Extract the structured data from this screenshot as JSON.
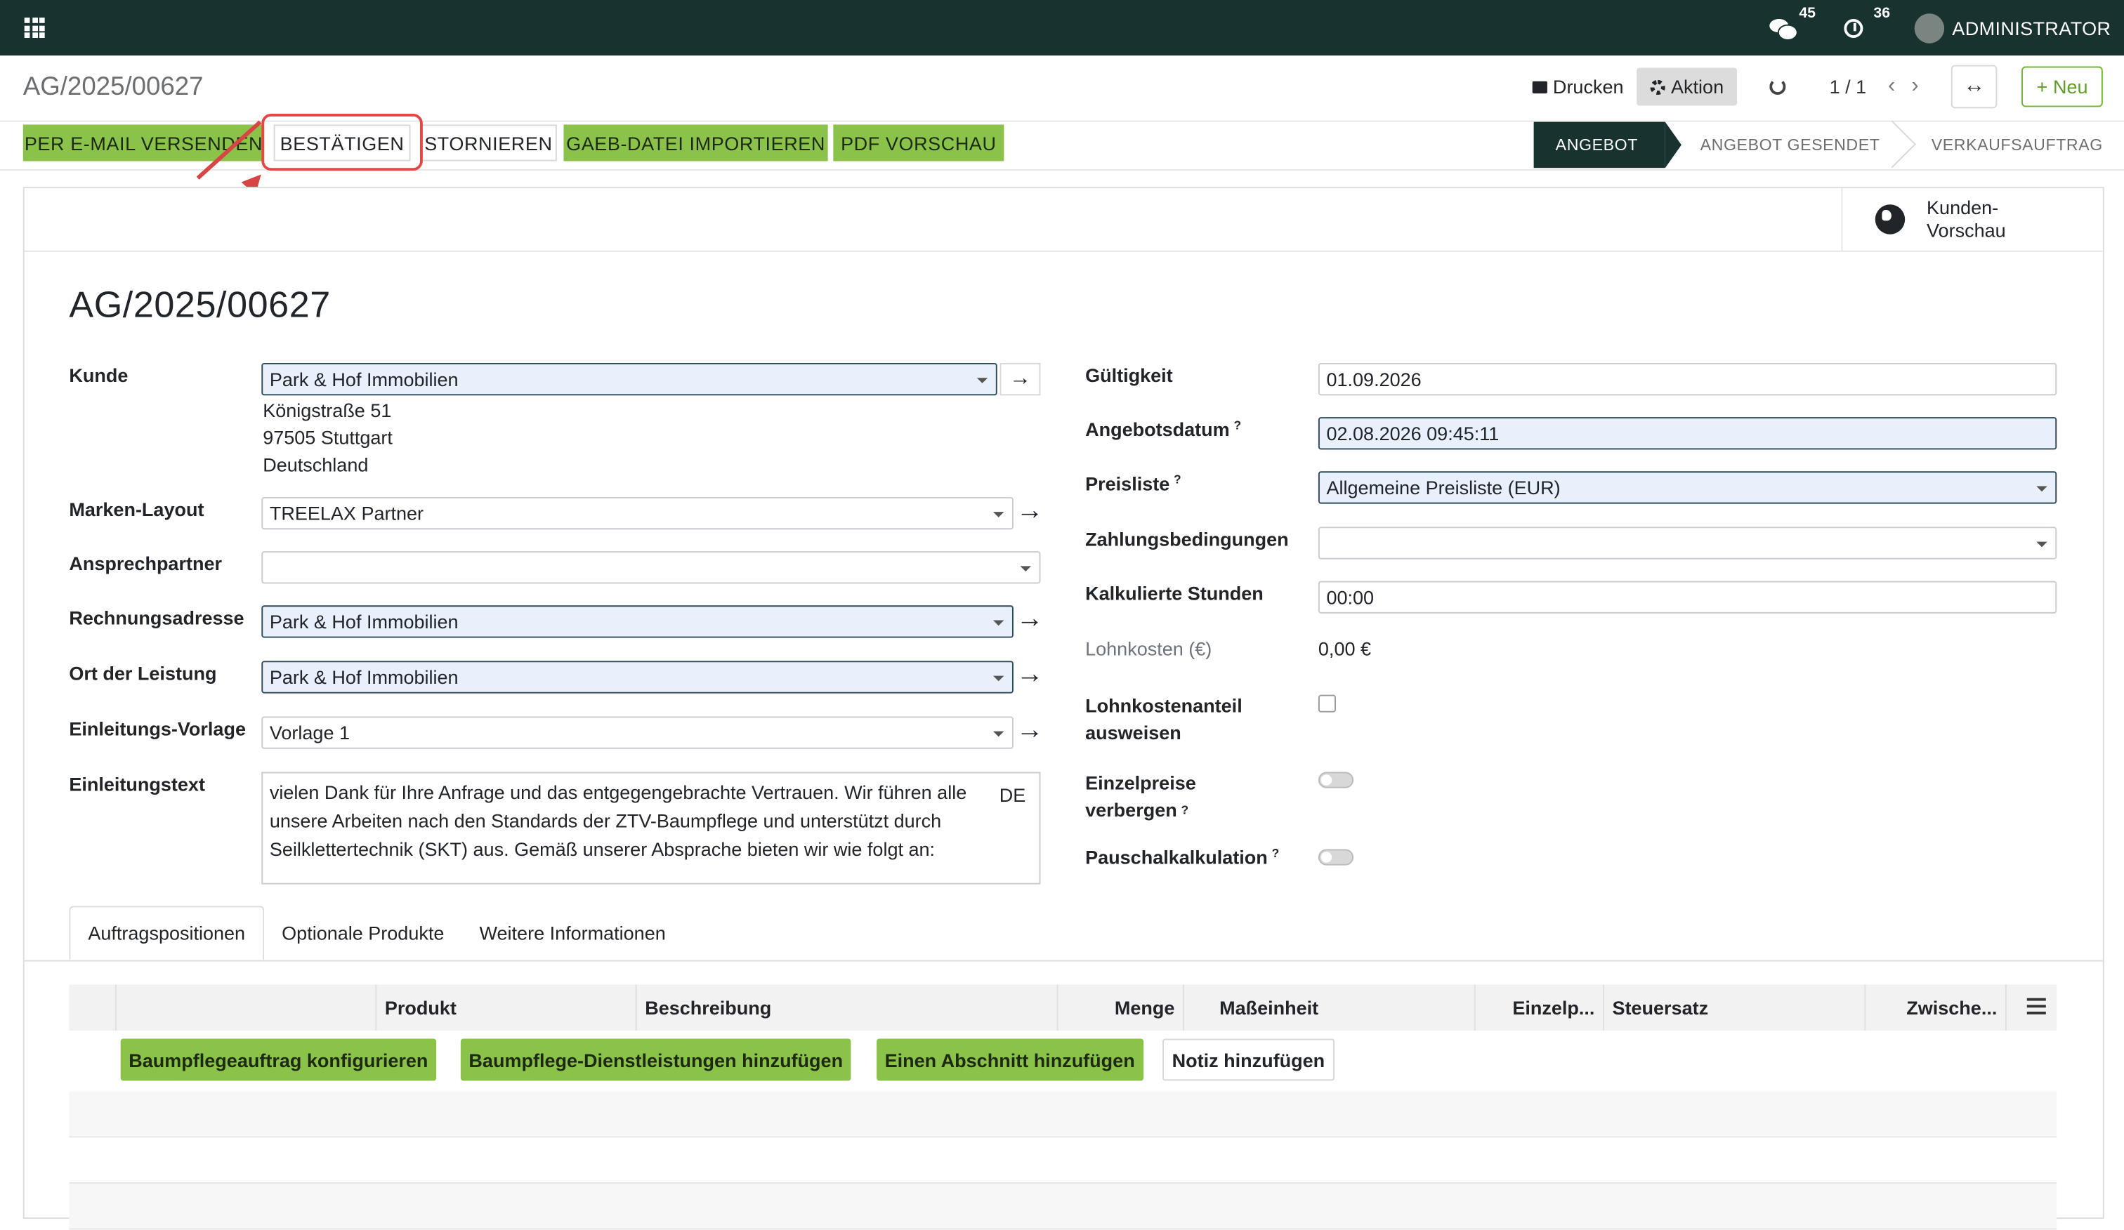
{
  "navbar": {
    "chat_count": "45",
    "activity_count": "36",
    "user_name": "ADMINISTRATOR"
  },
  "control_panel": {
    "breadcrumb": "AG/2025/00627",
    "print_label": "Drucken",
    "action_label": "Aktion",
    "pager": "1 / 1",
    "new_label": "Neu"
  },
  "statusbar": {
    "buttons": [
      "PER E-MAIL VERSENDEN",
      "BESTÄTIGEN",
      "STORNIEREN",
      "GAEB-DATEI IMPORTIEREN",
      "PDF VORSCHAU"
    ],
    "stages": [
      "ANGEBOT",
      "ANGEBOT GESENDET",
      "VERKAUFSAUFTRAG"
    ],
    "active_stage": "ANGEBOT"
  },
  "smart_button": {
    "line1": "Kunden-",
    "line2": "Vorschau"
  },
  "form": {
    "title": "AG/2025/00627",
    "left": {
      "kunde_label": "Kunde",
      "kunde_value": "Park & Hof Immobilien",
      "address": [
        "Königstraße 51",
        "97505 Stuttgart",
        "Deutschland"
      ],
      "marken_label": "Marken-Layout",
      "marken_value": "TREELAX Partner",
      "ansprech_label": "Ansprechpartner",
      "ansprech_value": "",
      "rechnung_label": "Rechnungsadresse",
      "rechnung_value": "Park & Hof Immobilien",
      "ort_label": "Ort der Leistung",
      "ort_value": "Park & Hof Immobilien",
      "vorlage_label": "Einleitungs-Vorlage",
      "vorlage_value": "Vorlage 1",
      "text_label": "Einleitungstext",
      "text_lines": [
        "vielen Dank für Ihre Anfrage und das entgegengebrachte Vertrauen. Wir führen alle",
        "unsere Arbeiten nach den Standards der ZTV-Baumpflege und unterstützt durch",
        "Seilklettertechnik (SKT) aus. Gemäß unserer Absprache bieten wir wie folgt an:"
      ],
      "text_lang": "DE"
    },
    "right": {
      "gueltig_label": "Gültigkeit",
      "gueltig_value": "01.09.2026",
      "angebotsdatum_label": "Angebotsdatum",
      "angebotsdatum_value": "02.08.2026 09:45:11",
      "preisliste_label": "Preisliste",
      "preisliste_value": "Allgemeine Preisliste (EUR)",
      "zahlung_label": "Zahlungsbedingungen",
      "zahlung_value": "",
      "stunden_label": "Kalkulierte Stunden",
      "stunden_value": "00:00",
      "lohnkosten_label": "Lohnkosten (€)",
      "lohnkosten_value": "0,00 €",
      "lohnanteil_label_1": "Lohnkostenanteil",
      "lohnanteil_label_2": "ausweisen",
      "einzelpreise_label_1": "Einzelpreise",
      "einzelpreise_label_2": "verbergen",
      "pauschal_label": "Pauschalkalkulation",
      "help_mark": "?"
    }
  },
  "tabs": [
    "Auftragspositionen",
    "Optionale Produkte",
    "Weitere Informationen"
  ],
  "table": {
    "columns": [
      "Produkt",
      "Beschreibung",
      "Menge",
      "Maßeinheit",
      "Einzelp...",
      "Steuersatz",
      "Zwische..."
    ],
    "actions": [
      "Baumpflegeauftrag konfigurieren",
      "Baumpflege-Dienstleistungen hinzufügen",
      "Einen Abschnitt hinzufügen",
      "Notiz hinzufügen"
    ]
  }
}
